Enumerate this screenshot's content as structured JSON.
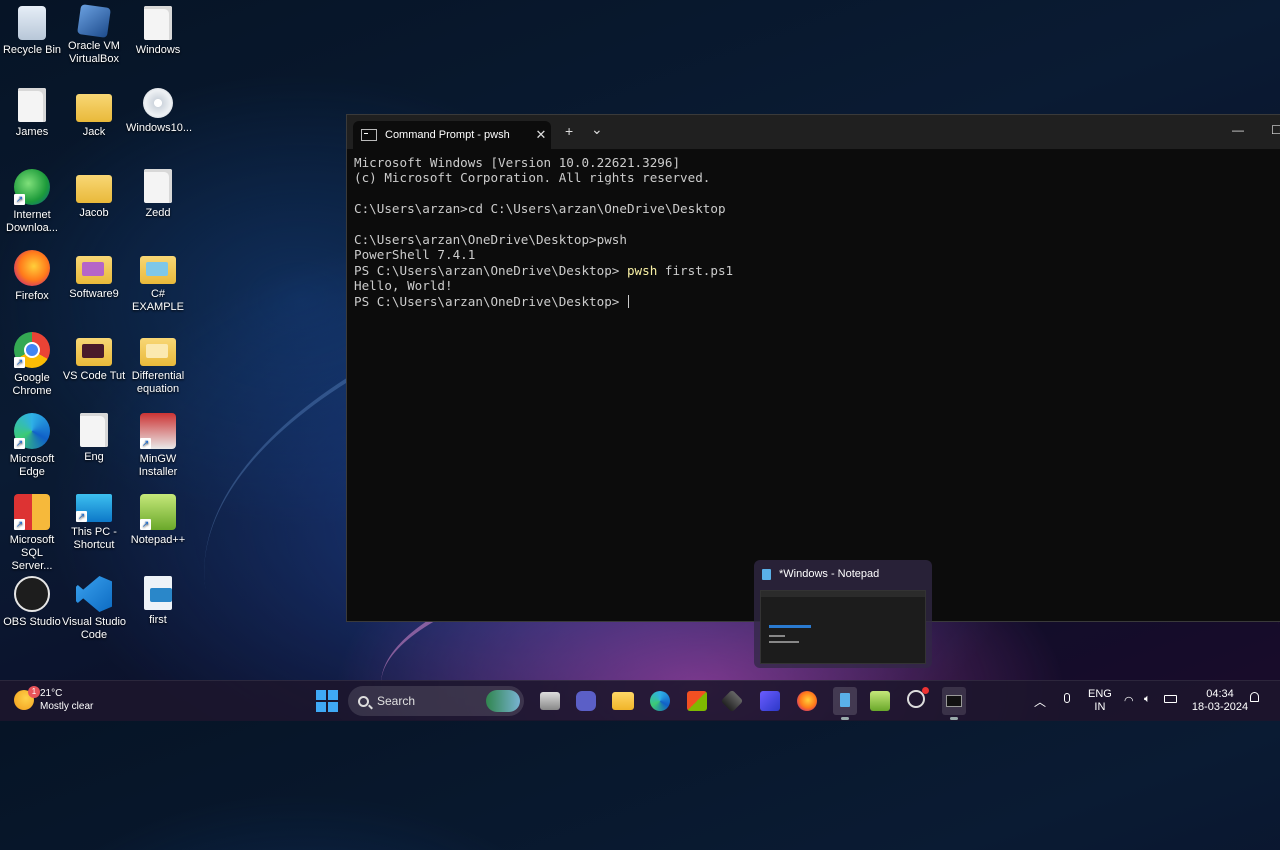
{
  "desktop": {
    "icons": [
      {
        "label": "Recycle Bin"
      },
      {
        "label": "Oracle VM VirtualBox"
      },
      {
        "label": "Windows"
      },
      {
        "label": "James"
      },
      {
        "label": "Jack"
      },
      {
        "label": "Windows10..."
      },
      {
        "label": "Internet Downloa..."
      },
      {
        "label": "Jacob"
      },
      {
        "label": "Zedd"
      },
      {
        "label": "Firefox"
      },
      {
        "label": "Software9"
      },
      {
        "label": "C# EXAMPLE"
      },
      {
        "label": "Google Chrome"
      },
      {
        "label": "VS Code Tut"
      },
      {
        "label": "Differential equation"
      },
      {
        "label": "Microsoft Edge"
      },
      {
        "label": "Eng"
      },
      {
        "label": "MinGW Installer"
      },
      {
        "label": "Microsoft SQL Server..."
      },
      {
        "label": "This PC - Shortcut"
      },
      {
        "label": "Notepad++"
      },
      {
        "label": "OBS Studio"
      },
      {
        "label": "Visual Studio Code"
      },
      {
        "label": "first"
      }
    ]
  },
  "terminal": {
    "tab_title": "Command Prompt - pwsh",
    "new_tab": "+",
    "dropdown": "⌄",
    "close": "✕",
    "minimize": "—",
    "maximize": "☐",
    "lines": [
      "Microsoft Windows [Version 10.0.22621.3296]",
      "(c) Microsoft Corporation. All rights reserved.",
      "",
      "C:\\Users\\arzan>cd C:\\Users\\arzan\\OneDrive\\Desktop",
      "",
      "C:\\Users\\arzan\\OneDrive\\Desktop>pwsh",
      "PowerShell 7.4.1"
    ],
    "ps_prompt": "PS C:\\Users\\arzan\\OneDrive\\Desktop> ",
    "ps_command": "pwsh",
    "ps_args": " first.ps1",
    "output": "Hello, World!",
    "ps_prompt_last": "PS C:\\Users\\arzan\\OneDrive\\Desktop> "
  },
  "notepad_preview": {
    "title": "*Windows - Notepad"
  },
  "taskbar": {
    "weather_temp": "21°C",
    "weather_desc": "Mostly clear",
    "weather_badge": "1",
    "search_label": "Search",
    "lang_line1": "ENG",
    "lang_line2": "IN",
    "time": "04:34",
    "date": "18-03-2024",
    "colors": {
      "accent": "#3fa9f5"
    }
  }
}
